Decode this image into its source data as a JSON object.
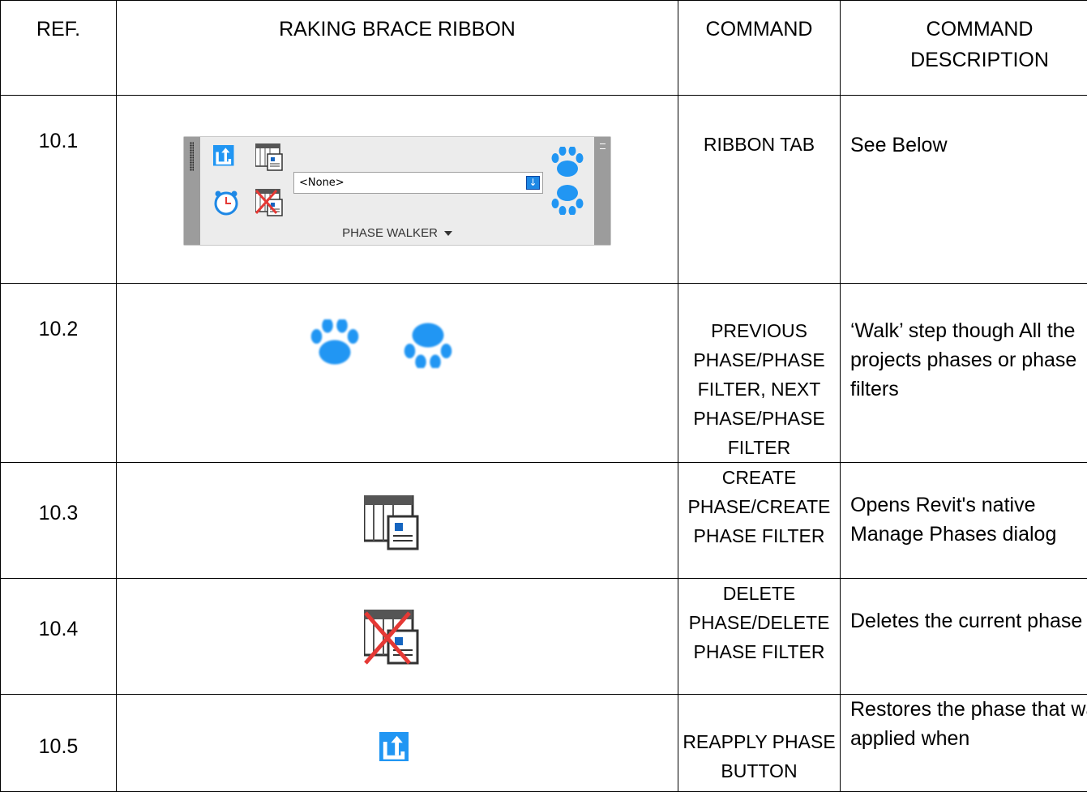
{
  "headers": {
    "ref": "REF.",
    "ribbon": "RAKING BRACE RIBBON",
    "command": "COMMAND",
    "description": "COMMAND DESCRIPTION"
  },
  "ribbon_panel": {
    "combo_value": "<None>",
    "title": "PHASE WALKER"
  },
  "rows": [
    {
      "ref": "10.1",
      "command": "RIBBON TAB",
      "description": "See Below"
    },
    {
      "ref": "10.2",
      "command": "PREVIOUS PHASE/PHASE FILTER, NEXT PHASE/PHASE FILTER",
      "description": "‘Walk’ step though All the projects phases or phase filters"
    },
    {
      "ref": "10.3",
      "command": "CREATE PHASE/CREATE PHASE FILTER",
      "description": "Opens Revit's native Manage Phases dialog"
    },
    {
      "ref": "10.4",
      "command": "DELETE PHASE/DELETE PHASE FILTER",
      "description": "Deletes the current phase"
    },
    {
      "ref": "10.5",
      "command": "REAPPLY PHASE BUTTON",
      "description": "Restores the phase that was applied when"
    }
  ],
  "icons": {
    "reapply": "reapply-phase-icon",
    "clock": "clock-icon",
    "create_phase": "create-phase-icon",
    "delete_phase": "delete-phase-icon",
    "previous": "paw-previous-icon",
    "next": "paw-next-icon",
    "accent": "#2196f3",
    "delete_red": "#e53935"
  }
}
